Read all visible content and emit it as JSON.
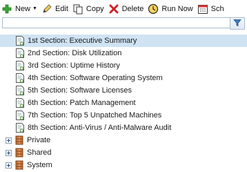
{
  "toolbar": {
    "new_label": "New",
    "edit_label": "Edit",
    "copy_label": "Copy",
    "delete_label": "Delete",
    "run_now_label": "Run Now",
    "schedule_label": "Sch"
  },
  "filter": {
    "value": "",
    "placeholder": ""
  },
  "tree": {
    "sections": [
      {
        "label": "1st Section: Executive Summary",
        "selected": true
      },
      {
        "label": "2nd Section: Disk Utilization",
        "selected": false
      },
      {
        "label": "3rd Section: Uptime History",
        "selected": false
      },
      {
        "label": "4th Section: Software Operating System",
        "selected": false
      },
      {
        "label": "5th Section: Software Licenses",
        "selected": false
      },
      {
        "label": "6th Section: Patch Management",
        "selected": false
      },
      {
        "label": "7th Section: Top 5 Unpatched Machines",
        "selected": false
      },
      {
        "label": "8th Section: Anti-Virus / Anti-Malware Audit",
        "selected": false
      }
    ],
    "folders": [
      {
        "label": "Private"
      },
      {
        "label": "Shared"
      },
      {
        "label": "System"
      }
    ]
  },
  "colors": {
    "selection": "#cfe3f3",
    "add_green": "#2e9a2e",
    "delete_red": "#cc2222"
  }
}
